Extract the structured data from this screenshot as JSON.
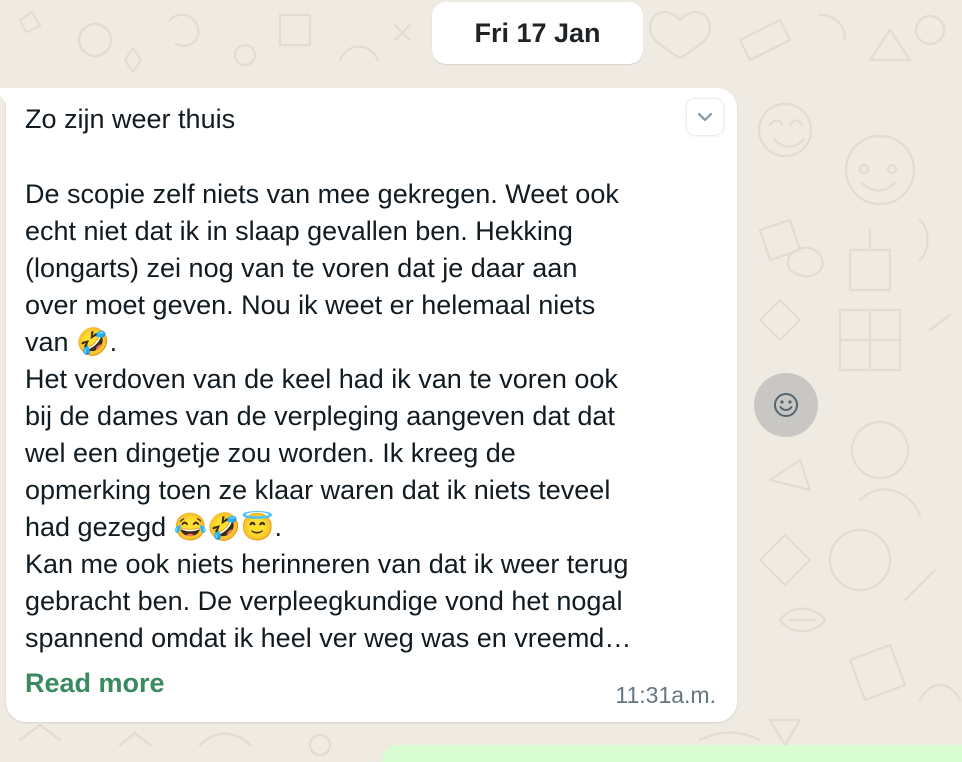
{
  "date_chip": "Fri 17 Jan",
  "message": {
    "title": "Zo zijn weer thuis",
    "lines": [
      "De scopie zelf niets van mee gekregen. Weet ook",
      "echt niet dat ik in slaap gevallen ben. Hekking",
      "(longarts) zei nog van te voren dat je daar aan",
      "over moet geven. Nou ik weet er helemaal niets",
      "van 🤣.",
      "Het verdoven van de keel had ik van te voren ook",
      "bij de dames van de verpleging aangeven dat dat",
      "wel een dingetje zou worden. Ik kreeg de",
      "opmerking toen ze klaar waren dat ik niets teveel",
      "had gezegd 😂🤣😇.",
      "Kan me ook niets herinneren van dat ik weer terug",
      "gebracht ben. De verpleegkundige vond het nogal",
      "spannend omdat ik heel ver weg was en vreemd…"
    ],
    "read_more": "Read more",
    "time": "11:31a.m."
  },
  "icons": {
    "menu": "chevron-down-icon",
    "react": "smiley-icon"
  },
  "colors": {
    "background": "#efeae2",
    "bubble": "#ffffff",
    "read_more": "#3b8a5f",
    "outgoing": "#d9fdd3"
  }
}
